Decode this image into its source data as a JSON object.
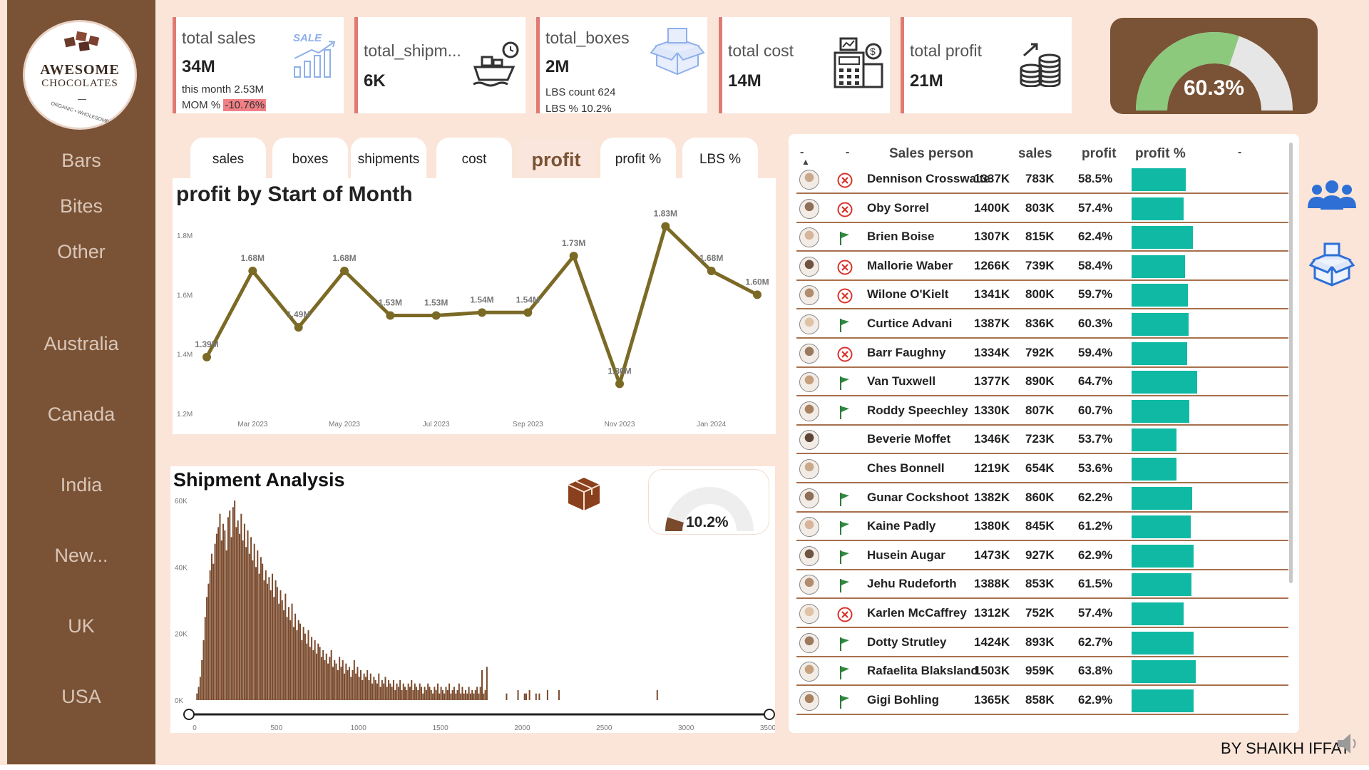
{
  "brand": {
    "name_line1": "AWESOME",
    "name_line2": "CHOCOLATES",
    "tagline": "ORGANIC • WHOLESOME"
  },
  "sidebar": {
    "items": [
      "Bars",
      "Bites",
      "Other",
      "Australia",
      "Canada",
      "India",
      "New...",
      "UK",
      "USA"
    ]
  },
  "kpis": {
    "sales": {
      "title": "total sales",
      "value": "34M",
      "sub1": "this month 2.53M",
      "sub2_label": "MOM % ",
      "sub2_value": "-10.76%",
      "icon": "sale-chart-icon",
      "icon_text": "SALE"
    },
    "shipments": {
      "title": "total_shipm...",
      "value": "6K",
      "icon": "cargo-ship-icon"
    },
    "boxes": {
      "title": "total_boxes",
      "value": "2M",
      "sub1": "LBS count 624",
      "sub2": "LBS % 10.2%",
      "icon": "open-box-icon"
    },
    "cost": {
      "title": "total cost",
      "value": "14M",
      "icon": "calculator-icon"
    },
    "profit": {
      "title": "total profit",
      "value": "21M",
      "icon": "coin-stack-icon"
    }
  },
  "gauge": {
    "value": "60.3%",
    "fraction": 0.603,
    "fill": "#8cc97d",
    "track": "#e6e6e6"
  },
  "tabs": [
    {
      "label": "sales"
    },
    {
      "label": "boxes"
    },
    {
      "label": "shipments"
    },
    {
      "label": "cost"
    },
    {
      "label": "profit",
      "active": true
    },
    {
      "label": "profit %"
    },
    {
      "label": "LBS %"
    }
  ],
  "chart_data": [
    {
      "type": "line",
      "title": "profit by Start of Month",
      "x": [
        "Feb 2023",
        "Mar 2023",
        "Apr 2023",
        "May 2023",
        "Jun 2023",
        "Jul 2023",
        "Aug 2023",
        "Sep 2023",
        "Oct 2023",
        "Nov 2023",
        "Dec 2023",
        "Jan 2024",
        "Feb 2024"
      ],
      "x_tick_labels": [
        "Mar 2023",
        "May 2023",
        "Jul 2023",
        "Sep 2023",
        "Nov 2023",
        "Jan 2024"
      ],
      "values": [
        1.39,
        1.68,
        1.49,
        1.68,
        1.53,
        1.53,
        1.54,
        1.54,
        1.73,
        1.3,
        1.83,
        1.68,
        1.6
      ],
      "labels": [
        "1.39M",
        "1.68M",
        "1.49M",
        "1.68M",
        "1.53M",
        "1.53M",
        "1.54M",
        "1.54M",
        "1.73M",
        "1.30M",
        "1.83M",
        "1.68M",
        "1.60M"
      ],
      "y_ticks": [
        "1.2M",
        "1.4M",
        "1.6M",
        "1.8M"
      ],
      "ylim": [
        1.2,
        1.8
      ],
      "color": "#7b6a25",
      "grid": false
    },
    {
      "type": "bar",
      "title": "Shipment Analysis",
      "x_ticks": [
        "0",
        "500",
        "1000",
        "1500",
        "2000",
        "2500",
        "3000",
        "3500"
      ],
      "y_ticks": [
        "0K",
        "20K",
        "40K",
        "60K"
      ],
      "xlim": [
        0,
        3500
      ],
      "ylim": [
        0,
        60
      ],
      "color": "#7a4a2c",
      "bin_width": 10,
      "bins_start": [
        10,
        20,
        30,
        40,
        50,
        60,
        70,
        80,
        90,
        100,
        110,
        120,
        130,
        140,
        150,
        160,
        170,
        180,
        190,
        200,
        210,
        220,
        230,
        240,
        250,
        260,
        270,
        280,
        290,
        300,
        310,
        320,
        330,
        340,
        350,
        360,
        370,
        380,
        390,
        400,
        410,
        420,
        430,
        440,
        450,
        460,
        470,
        480,
        490,
        500,
        510,
        520,
        530,
        540,
        550,
        560,
        570,
        580,
        590,
        600,
        610,
        620,
        630,
        640,
        650,
        660,
        670,
        680,
        690,
        700,
        710,
        720,
        730,
        740,
        750,
        760,
        770,
        780,
        790,
        800,
        810,
        820,
        830,
        840,
        850,
        860,
        870,
        880,
        890,
        900,
        910,
        920,
        930,
        940,
        950,
        960,
        970,
        980,
        990,
        1000,
        1010,
        1020,
        1030,
        1040,
        1050,
        1060,
        1070,
        1080,
        1090,
        1100,
        1110,
        1120,
        1130,
        1140,
        1150,
        1160,
        1170,
        1180,
        1190,
        1200,
        1210,
        1220,
        1230,
        1240,
        1250,
        1260,
        1270,
        1280,
        1290,
        1300,
        1310,
        1320,
        1330,
        1340,
        1350,
        1360,
        1370,
        1380,
        1390,
        1400,
        1410,
        1420,
        1430,
        1440,
        1450,
        1460,
        1470,
        1480,
        1490,
        1500,
        1510,
        1520,
        1530,
        1540,
        1550,
        1560,
        1570,
        1580,
        1590,
        1600,
        1610,
        1620,
        1630,
        1640,
        1650,
        1660,
        1670,
        1680,
        1690,
        1700,
        1710,
        1720,
        1730,
        1740,
        1750,
        1760,
        1770,
        1780,
        1900,
        1970,
        2010,
        2020,
        2040,
        2080,
        2100,
        2150,
        2220,
        2820,
        2880,
        2940,
        2990,
        3040
      ],
      "values": [
        2,
        4,
        7,
        12,
        18,
        25,
        31,
        35,
        39,
        44,
        41,
        47,
        50,
        52,
        56,
        48,
        53,
        51,
        45,
        55,
        57,
        49,
        58,
        60,
        52,
        54,
        50,
        56,
        48,
        53,
        46,
        51,
        44,
        49,
        42,
        47,
        40,
        45,
        38,
        43,
        41,
        36,
        39,
        35,
        37,
        33,
        38,
        31,
        36,
        34,
        29,
        33,
        30,
        27,
        32,
        25,
        28,
        24,
        29,
        22,
        26,
        21,
        24,
        23,
        18,
        22,
        20,
        17,
        21,
        16,
        19,
        15,
        18,
        14,
        17,
        16,
        13,
        15,
        12,
        14,
        11,
        13,
        15,
        10,
        12,
        11,
        9,
        13,
        10,
        12,
        8,
        11,
        9,
        10,
        7,
        9,
        12,
        8,
        10,
        7,
        9,
        6,
        8,
        7,
        9,
        6,
        8,
        5,
        7,
        6,
        5,
        8,
        4,
        6,
        5,
        7,
        4,
        6,
        5,
        4,
        6,
        3,
        5,
        4,
        6,
        3,
        5,
        4,
        3,
        5,
        4,
        6,
        3,
        5,
        4,
        3,
        5,
        4,
        2,
        4,
        3,
        5,
        4,
        3,
        2,
        4,
        3,
        5,
        2,
        4,
        3,
        2,
        4,
        3,
        5,
        2,
        3,
        4,
        2,
        3,
        5,
        2,
        4,
        2,
        3,
        2,
        4,
        2,
        3,
        2,
        3,
        4,
        2,
        4,
        9,
        2,
        3,
        10,
        2,
        3,
        2,
        2,
        3,
        2,
        2,
        3,
        3,
        3
      ],
      "lbs_gauge": {
        "value": "10.2%",
        "fraction": 0.102,
        "fill": "#7a4a2c",
        "track": "#eeeeee"
      },
      "icon": "box-icon"
    }
  ],
  "table": {
    "headers": {
      "sort": "-",
      "status": "-",
      "person": "Sales person",
      "sales": "sales",
      "profit": "profit",
      "pct": "profit %",
      "bar": "-"
    },
    "rows": [
      {
        "name": "Dennison Crosswaite",
        "sales": "1337K",
        "profit": "783K",
        "pct": "58.5%",
        "pct_num": 58.5,
        "status": "cross"
      },
      {
        "name": "Oby Sorrel",
        "sales": "1400K",
        "profit": "803K",
        "pct": "57.4%",
        "pct_num": 57.4,
        "status": "cross"
      },
      {
        "name": "Brien Boise",
        "sales": "1307K",
        "profit": "815K",
        "pct": "62.4%",
        "pct_num": 62.4,
        "status": "flag"
      },
      {
        "name": "Mallorie Waber",
        "sales": "1266K",
        "profit": "739K",
        "pct": "58.4%",
        "pct_num": 58.4,
        "status": "cross"
      },
      {
        "name": "Wilone O'Kielt",
        "sales": "1341K",
        "profit": "800K",
        "pct": "59.7%",
        "pct_num": 59.7,
        "status": "cross"
      },
      {
        "name": "Curtice Advani",
        "sales": "1387K",
        "profit": "836K",
        "pct": "60.3%",
        "pct_num": 60.3,
        "status": "flag"
      },
      {
        "name": "Barr Faughny",
        "sales": "1334K",
        "profit": "792K",
        "pct": "59.4%",
        "pct_num": 59.4,
        "status": "cross"
      },
      {
        "name": "Van Tuxwell",
        "sales": "1377K",
        "profit": "890K",
        "pct": "64.7%",
        "pct_num": 64.7,
        "status": "flag"
      },
      {
        "name": "Roddy Speechley",
        "sales": "1330K",
        "profit": "807K",
        "pct": "60.7%",
        "pct_num": 60.7,
        "status": "flag"
      },
      {
        "name": "Beverie Moffet",
        "sales": "1346K",
        "profit": "723K",
        "pct": "53.7%",
        "pct_num": 53.7,
        "status": "none"
      },
      {
        "name": "Ches Bonnell",
        "sales": "1219K",
        "profit": "654K",
        "pct": "53.6%",
        "pct_num": 53.6,
        "status": "none"
      },
      {
        "name": "Gunar Cockshoot",
        "sales": "1382K",
        "profit": "860K",
        "pct": "62.2%",
        "pct_num": 62.2,
        "status": "flag"
      },
      {
        "name": "Kaine Padly",
        "sales": "1380K",
        "profit": "845K",
        "pct": "61.2%",
        "pct_num": 61.2,
        "status": "flag"
      },
      {
        "name": "Husein Augar",
        "sales": "1473K",
        "profit": "927K",
        "pct": "62.9%",
        "pct_num": 62.9,
        "status": "flag"
      },
      {
        "name": "Jehu Rudeforth",
        "sales": "1388K",
        "profit": "853K",
        "pct": "61.5%",
        "pct_num": 61.5,
        "status": "flag"
      },
      {
        "name": "Karlen McCaffrey",
        "sales": "1312K",
        "profit": "752K",
        "pct": "57.4%",
        "pct_num": 57.4,
        "status": "cross"
      },
      {
        "name": "Dotty Strutley",
        "sales": "1424K",
        "profit": "893K",
        "pct": "62.7%",
        "pct_num": 62.7,
        "status": "flag"
      },
      {
        "name": "Rafaelita Blaksland",
        "sales": "1503K",
        "profit": "959K",
        "pct": "63.8%",
        "pct_num": 63.8,
        "status": "flag"
      },
      {
        "name": "Gigi Bohling",
        "sales": "1365K",
        "profit": "858K",
        "pct": "62.9%",
        "pct_num": 62.9,
        "status": "flag"
      }
    ]
  },
  "right_icons": [
    "team-icon",
    "box-icon"
  ],
  "byline": "BY SHAIKH IFFAT",
  "colors": {
    "brown": "#7a5235",
    "teal": "#10b9a3",
    "accent_red": "#e07a72",
    "background": "#fbe5d9"
  }
}
